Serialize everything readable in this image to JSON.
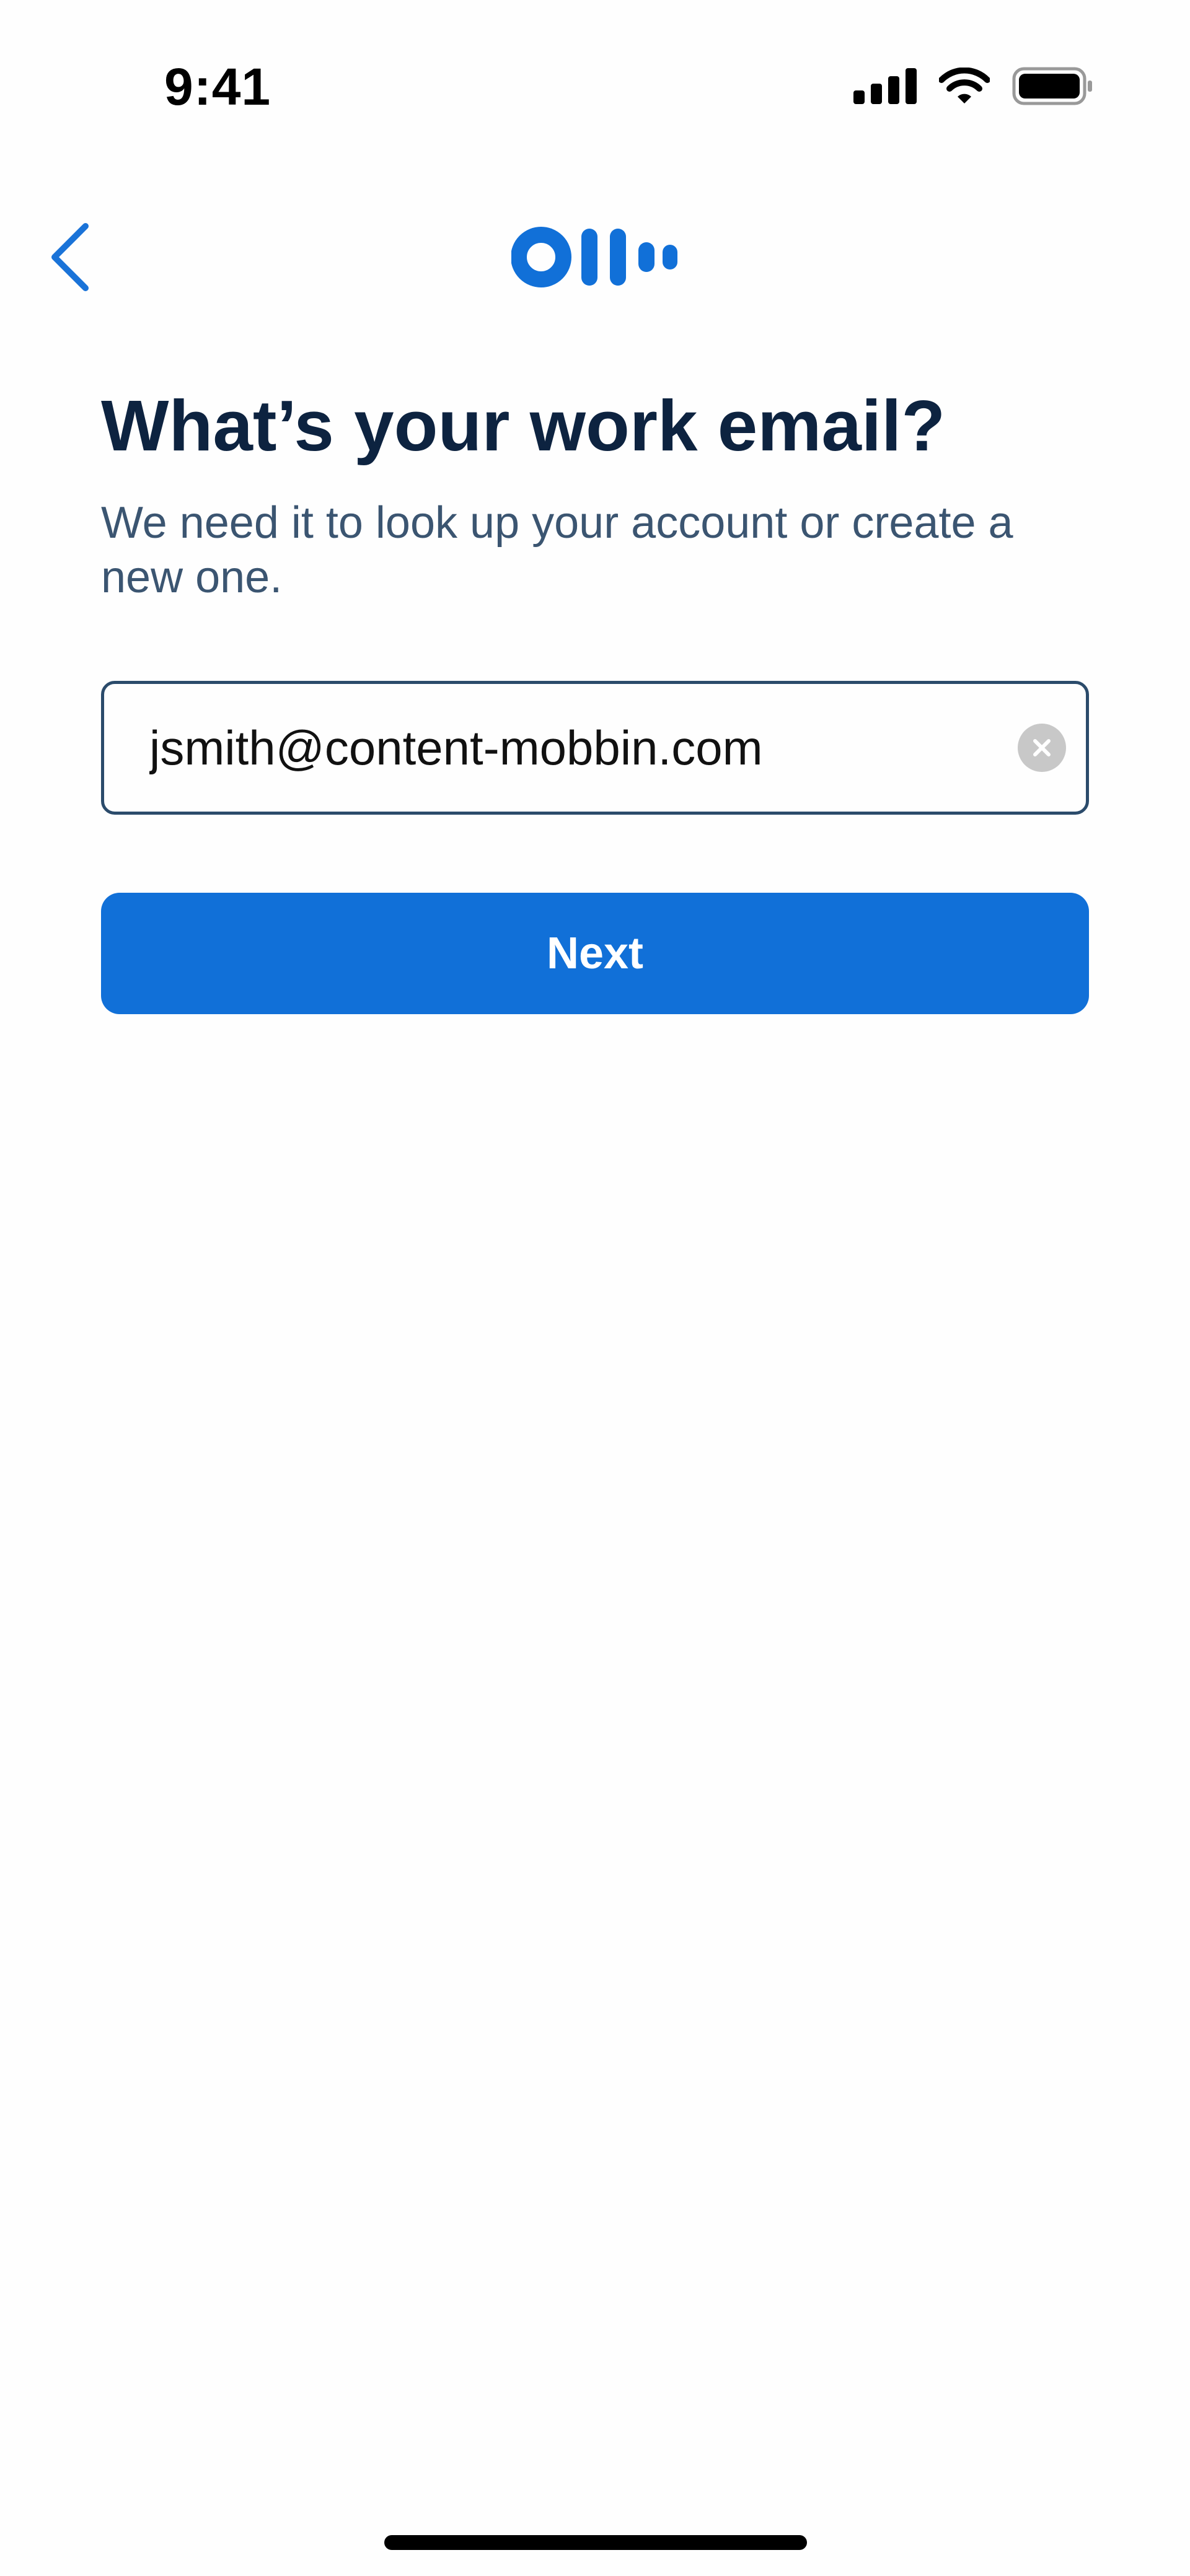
{
  "status_bar": {
    "time": "9:41",
    "icons": [
      "cellular-signal-icon",
      "wifi-icon",
      "battery-icon"
    ]
  },
  "nav": {
    "back_icon": "chevron-left-icon",
    "logo": "otter-logo"
  },
  "content": {
    "title": "What’s your work email?",
    "subtitle": "We need it to look up your account or create a new one.",
    "email_value": "jsmith@content-mobbin.com",
    "clear_icon": "clear-icon",
    "next_label": "Next"
  },
  "colors": {
    "accent": "#1170d8",
    "title": "#0d2340",
    "subtitle": "#3b5571",
    "input_border": "#2b4b6b",
    "clear_button": "#c8c8c8"
  }
}
